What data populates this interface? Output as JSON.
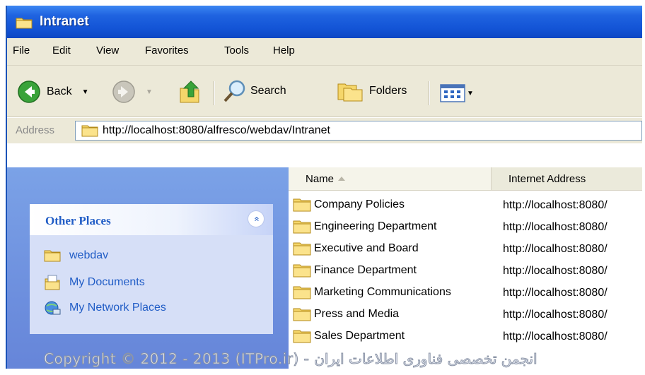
{
  "window": {
    "title": "Intranet"
  },
  "menu": [
    "File",
    "Edit",
    "View",
    "Favorites",
    "Tools",
    "Help"
  ],
  "toolbar": {
    "back_label": "Back",
    "search_label": "Search",
    "folders_label": "Folders"
  },
  "address": {
    "label": "Address",
    "value": "http://localhost:8080/alfresco/webdav/Intranet"
  },
  "other_places": {
    "title": "Other Places",
    "collapse_glyph": "«",
    "items": [
      {
        "label": "webdav",
        "icon": "folder-icon"
      },
      {
        "label": "My Documents",
        "icon": "my-documents-icon"
      },
      {
        "label": "My Network Places",
        "icon": "network-places-icon"
      }
    ]
  },
  "columns": {
    "name": "Name",
    "internet_address": "Internet Address"
  },
  "files": [
    {
      "name": "Company Policies",
      "address": "http://localhost:8080/"
    },
    {
      "name": "Engineering Department",
      "address": "http://localhost:8080/"
    },
    {
      "name": "Executive and Board",
      "address": "http://localhost:8080/"
    },
    {
      "name": "Finance Department",
      "address": "http://localhost:8080/"
    },
    {
      "name": "Marketing Communications",
      "address": "http://localhost:8080/"
    },
    {
      "name": "Press and Media",
      "address": "http://localhost:8080/"
    },
    {
      "name": "Sales Department",
      "address": "http://localhost:8080/"
    }
  ],
  "watermark": "Copyright © 2012 - 2013 (ITPro.ir) - انجمن تخصصی فناوری اطلاعات ایران",
  "colors": {
    "titlebar": "#1354d6",
    "link_blue": "#215dc6",
    "chrome": "#ece9d8"
  }
}
